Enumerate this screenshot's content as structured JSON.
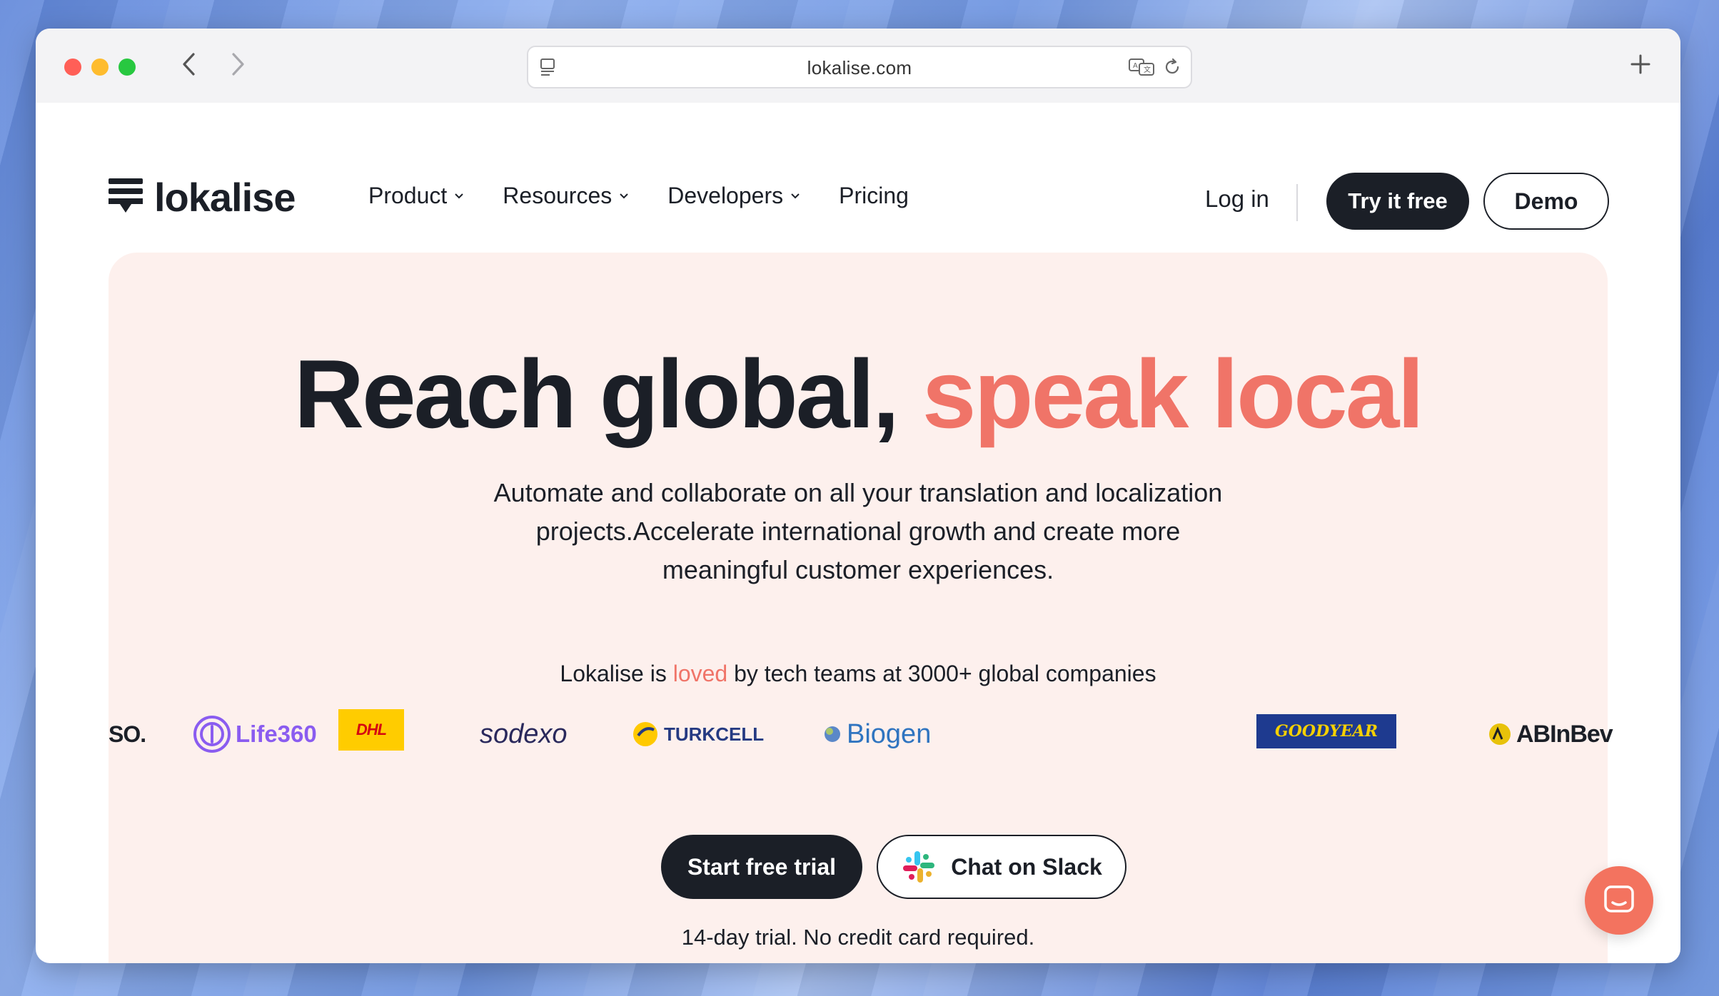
{
  "browser": {
    "url": "lokalise.com"
  },
  "header": {
    "logo_text": "lokalise",
    "nav": [
      {
        "label": "Product",
        "has_dropdown": true
      },
      {
        "label": "Resources",
        "has_dropdown": true
      },
      {
        "label": "Developers",
        "has_dropdown": true
      },
      {
        "label": "Pricing",
        "has_dropdown": false
      }
    ],
    "login_label": "Log in",
    "try_label": "Try it free",
    "demo_label": "Demo"
  },
  "hero": {
    "headline_main": "Reach global,",
    "headline_accent": "speak local",
    "subtext": "Automate and collaborate on all your translation and localization projects.Accelerate international growth and create more meaningful customer experiences.",
    "proof_prefix": "Lokalise is",
    "proof_loved": "loved",
    "proof_suffix": "by tech teams at 3000+ global companies",
    "logos": [
      "SO.",
      "Life360",
      "DHL",
      "sodexo",
      "TURKCELL",
      "Biogen",
      "GOODYEAR",
      "ABInBev"
    ],
    "start_label": "Start free trial",
    "slack_label": "Chat on Slack",
    "trial_note": "14-day trial. No credit card required."
  },
  "colors": {
    "accent": "#f07468",
    "dark": "#1b1f27",
    "hero_bg": "#fdf0ed"
  }
}
